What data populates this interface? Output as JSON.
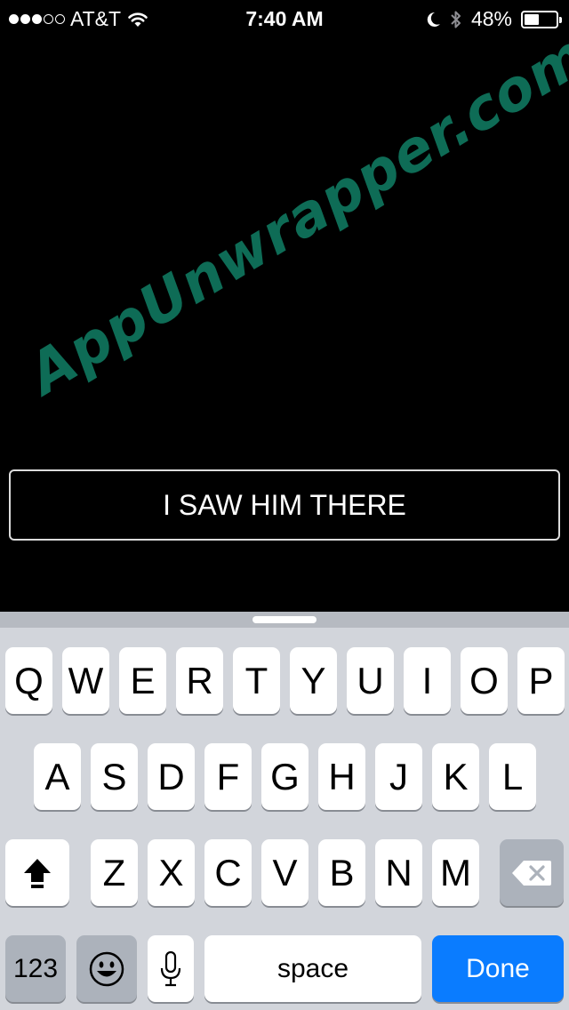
{
  "status_bar": {
    "carrier": "AT&T",
    "signal_bars_filled": 3,
    "signal_bars_total": 5,
    "time": "7:40 AM",
    "battery_percent": "48%",
    "battery_level": 0.48,
    "icons": [
      "wifi-icon",
      "moon-icon",
      "bluetooth-icon",
      "battery-icon"
    ]
  },
  "watermark": "AppUnwrapper.com",
  "answer": {
    "text": "I SAW HIM THERE"
  },
  "keyboard": {
    "row1": [
      "Q",
      "W",
      "E",
      "R",
      "T",
      "Y",
      "U",
      "I",
      "O",
      "P"
    ],
    "row2": [
      "A",
      "S",
      "D",
      "F",
      "G",
      "H",
      "J",
      "K",
      "L"
    ],
    "row3": [
      "Z",
      "X",
      "C",
      "V",
      "B",
      "N",
      "M"
    ],
    "numbers_label": "123",
    "space_label": "space",
    "done_label": "Done",
    "icons": [
      "shift-icon",
      "delete-icon",
      "emoji-icon",
      "microphone-icon"
    ]
  },
  "colors": {
    "background": "#000000",
    "watermark": "#0e6c56",
    "done_key": "#0a7cff",
    "keyboard_bg": "#d2d5db"
  }
}
